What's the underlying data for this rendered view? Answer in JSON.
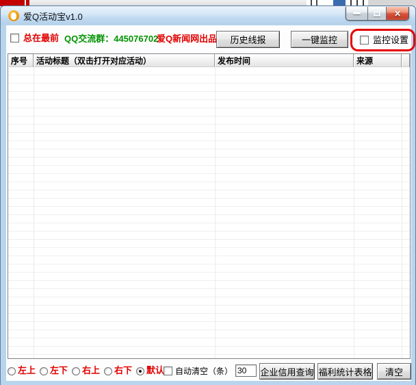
{
  "window": {
    "title": "爱Q活动宝v1.0",
    "close_glyph": "✕"
  },
  "icons": {
    "app_icon": "penguin-icon",
    "minimize_icon": "minimize-bar-icon",
    "maximize_icon": "maximize-square-icon",
    "close_icon": "close-x-icon"
  },
  "toolbar": {
    "always_on_top_label": "总在最前",
    "always_on_top_checked": false,
    "qq_group_text": "QQ交流群：445076702",
    "brand_text": "爱Q新闻网出品",
    "history_button_label": "历史线报",
    "monitor_button_label": "一键监控",
    "monitor_settings_label": "监控设置",
    "monitor_settings_checked": false,
    "monitor_settings_highlighted": true
  },
  "table": {
    "headers": [
      "序号",
      "活动标题（双击打开对应活动）",
      "发布时间",
      "来源"
    ],
    "rows": []
  },
  "footer": {
    "positions": [
      {
        "label": "左上",
        "selected": false
      },
      {
        "label": "左下",
        "selected": false
      },
      {
        "label": "右上",
        "selected": false
      },
      {
        "label": "右下",
        "selected": false
      },
      {
        "label": "默认",
        "selected": true
      }
    ],
    "auto_clear_label": "自动清空（条）",
    "auto_clear_checked": false,
    "auto_clear_value": "30",
    "credit_query_button_label": "企业信用查询",
    "welfare_table_button_label": "福利统计表格",
    "clear_button_label": "清空"
  },
  "colors": {
    "label_red": "#e10000",
    "qq_green": "#009300",
    "annotation_red": "#e60000",
    "frame_blue": "#b9d5ee",
    "close_button_red": "#d7553b"
  }
}
